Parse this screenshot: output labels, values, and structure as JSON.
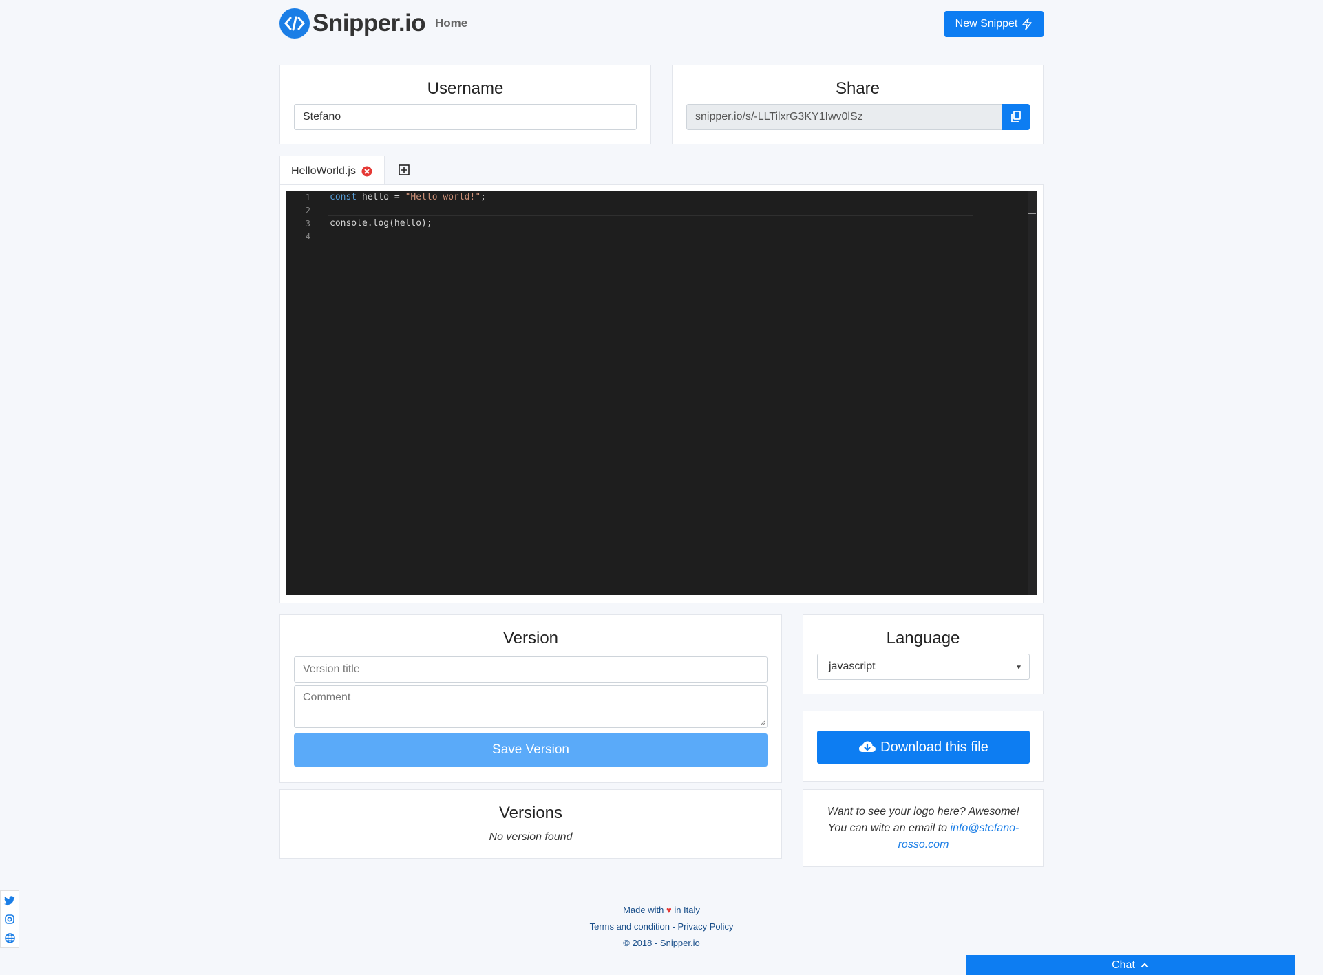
{
  "navbar": {
    "brand": "Snipper.io",
    "home_link": "Home",
    "new_snippet_label": "New Snippet"
  },
  "username": {
    "title": "Username",
    "value": "Stefano"
  },
  "share": {
    "title": "Share",
    "url": "snipper.io/s/-LLTilxrG3KY1Iwv0lSz"
  },
  "tabs": [
    {
      "label": "HelloWorld.js"
    }
  ],
  "editor": {
    "lines": [
      {
        "number": "1"
      },
      {
        "number": "2"
      },
      {
        "number": "3"
      },
      {
        "number": "4"
      }
    ],
    "line1_kw": "const",
    "line1_mid": " hello = ",
    "line1_str": "\"Hello world!\"",
    "line1_end": ";",
    "line3": "console.log(hello);"
  },
  "version": {
    "title": "Version",
    "title_placeholder": "Version title",
    "comment_placeholder": "Comment",
    "save_label": "Save Version"
  },
  "versions": {
    "title": "Versions",
    "empty_text": "No version found"
  },
  "language": {
    "title": "Language",
    "selected": "javascript"
  },
  "download": {
    "label": "Download this file"
  },
  "ad": {
    "line1": "Want to see your logo here? Awesome!",
    "line2_prefix": "You can wite an email to ",
    "email_part1": "info@stefano-",
    "email_part2": "rosso.com"
  },
  "footer": {
    "made_prefix": "Made with",
    "made_suffix": "in Italy",
    "terms": "Terms and condition",
    "separator": " - ",
    "privacy": "Privacy Policy",
    "copyright": "© 2018 - Snipper.io"
  },
  "chat": {
    "label": "Chat"
  },
  "colors": {
    "primary": "#0d7df2",
    "primary_light": "#5aaaf9",
    "editor_bg": "#1e1e1e",
    "close_tab": "#e53935"
  },
  "icons": {
    "logo": "code-brackets-icon",
    "new_snippet": "lightning-icon",
    "copy": "copy-icon",
    "tab_close": "close-circle-icon",
    "tab_add": "plus-square-icon",
    "download": "cloud-download-icon",
    "chat": "chevron-up-icon",
    "social": [
      "twitter-icon",
      "instagram-icon",
      "globe-icon"
    ]
  }
}
